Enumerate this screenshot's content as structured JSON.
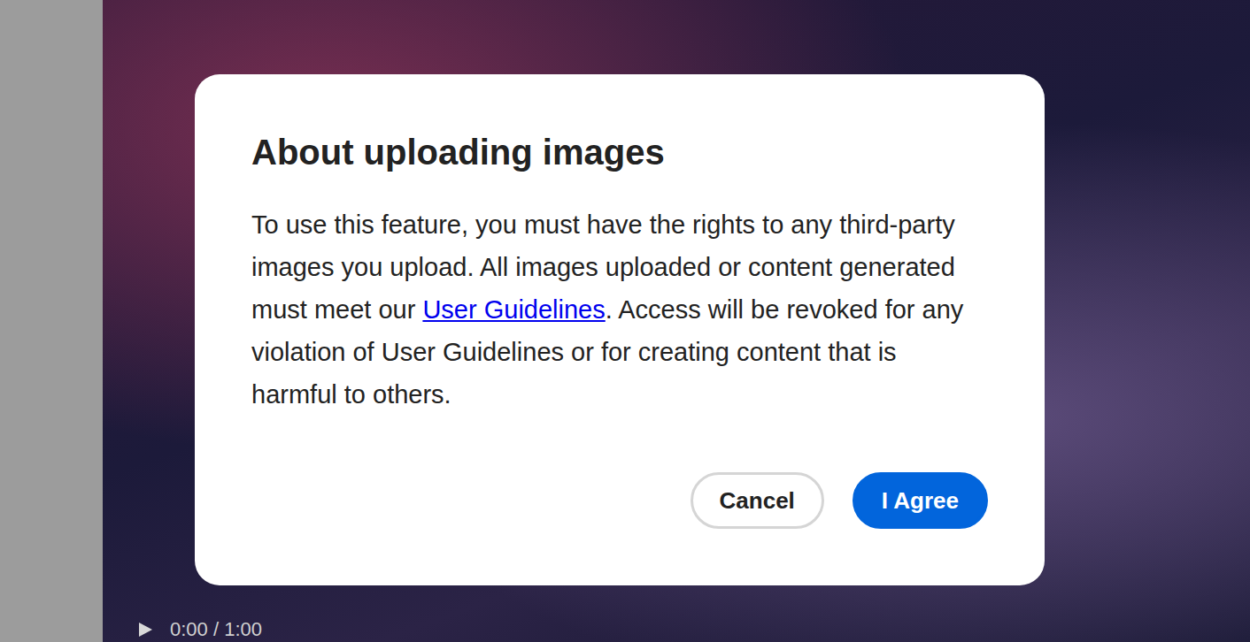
{
  "dialog": {
    "title": "About uploading images",
    "body_before_link": "To use this feature, you must have the rights to any third-party images you upload. All images uploaded or content generated must meet our ",
    "link": "User Guidelines",
    "body_after_link": ". Access will be revoked for any violation of User Guidelines or for creating content that is harmful to others.",
    "buttons": [
      {
        "label": "Cancel",
        "kind": "secondary"
      },
      {
        "label": "I Agree",
        "kind": "primary"
      }
    ]
  },
  "player": {
    "time": "0:00 / 1:00",
    "playing": false
  }
}
